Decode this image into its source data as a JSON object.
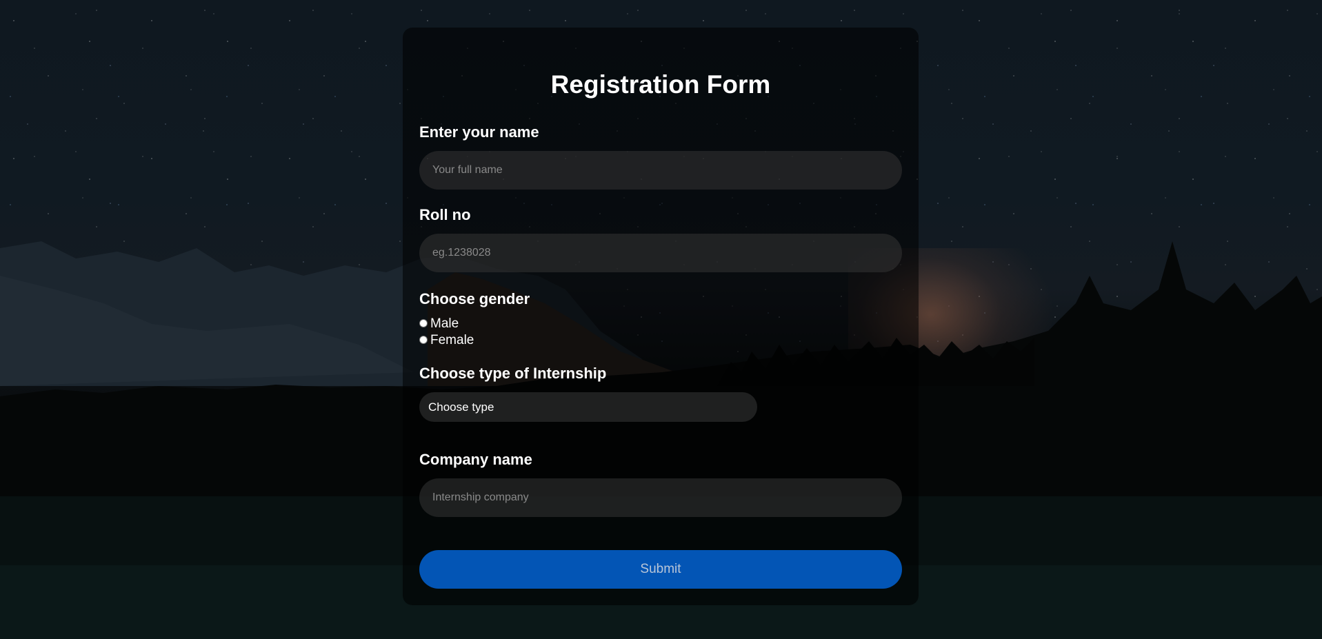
{
  "form": {
    "title": "Registration Form",
    "name_label": "Enter your name",
    "name_placeholder": "Your full name",
    "roll_label": "Roll no",
    "roll_placeholder": "eg.1238028",
    "gender_label": "Choose gender",
    "gender_options": [
      "Male",
      "Female"
    ],
    "internship_label": "Choose type of Internship",
    "internship_selected": "Choose type",
    "company_label": "Company name",
    "company_placeholder": "Internship company",
    "submit_label": "Submit"
  },
  "colors": {
    "submit_button": "#0355b5",
    "card_background": "rgba(0,0,0,0.55)",
    "input_background": "rgba(52,52,52,0.55)"
  }
}
